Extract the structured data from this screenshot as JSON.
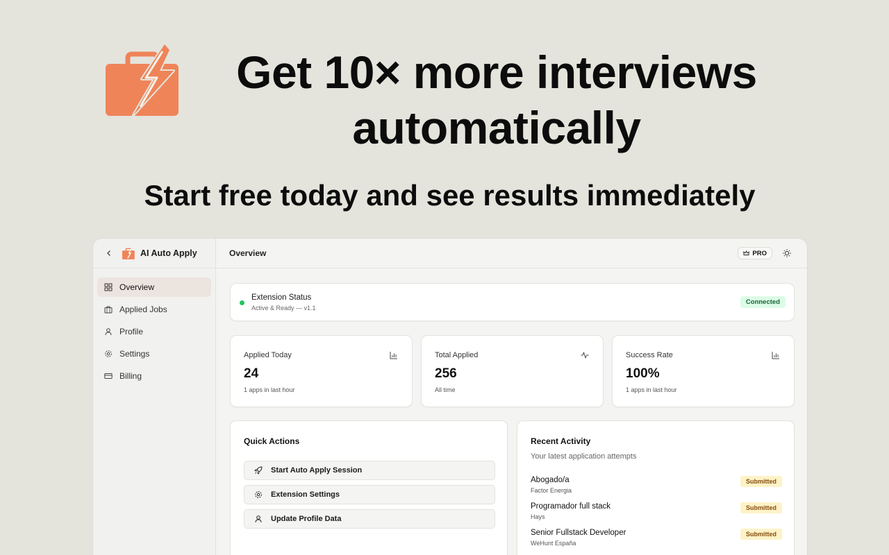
{
  "hero": {
    "title": "Get 10× more interviews automatically",
    "subtitle": "Start free today and see results immediately",
    "logo_icon": "briefcase-lightning-icon",
    "brand_color": "#ef8459"
  },
  "sidebar": {
    "brand_name": "AI Auto Apply",
    "back_icon": "chevron-left-icon",
    "items": [
      {
        "label": "Overview",
        "icon": "grid-icon",
        "active": true
      },
      {
        "label": "Applied Jobs",
        "icon": "briefcase-icon",
        "active": false
      },
      {
        "label": "Profile",
        "icon": "user-icon",
        "active": false
      },
      {
        "label": "Settings",
        "icon": "gear-icon",
        "active": false
      },
      {
        "label": "Billing",
        "icon": "credit-card-icon",
        "active": false
      }
    ]
  },
  "topbar": {
    "title": "Overview",
    "pro_label": "PRO",
    "theme_icon": "sun-icon"
  },
  "extension_status": {
    "title": "Extension Status",
    "subtitle": "Active & Ready — v1.1",
    "badge": "Connected",
    "status_color": "#22c55e"
  },
  "stats": [
    {
      "label": "Applied Today",
      "value": "24",
      "note": "1 apps in last hour",
      "icon": "bar-chart-icon"
    },
    {
      "label": "Total Applied",
      "value": "256",
      "note": "All time",
      "icon": "activity-icon"
    },
    {
      "label": "Success Rate",
      "value": "100%",
      "note": "1 apps in last hour",
      "icon": "bar-chart-icon"
    }
  ],
  "quick_actions": {
    "title": "Quick Actions",
    "buttons": [
      {
        "label": "Start Auto Apply Session",
        "icon": "rocket-icon"
      },
      {
        "label": "Extension Settings",
        "icon": "gear-icon"
      },
      {
        "label": "Update Profile Data",
        "icon": "user-icon"
      }
    ]
  },
  "recent_activity": {
    "title": "Recent Activity",
    "subtitle": "Your latest application attempts",
    "items": [
      {
        "title": "Abogado/a",
        "company": "Factor Energia",
        "status": "Submitted"
      },
      {
        "title": "Programador full stack",
        "company": "Hays",
        "status": "Submitted"
      },
      {
        "title": "Senior Fullstack Developer",
        "company": "WeHunt España",
        "status": "Submitted"
      }
    ]
  }
}
